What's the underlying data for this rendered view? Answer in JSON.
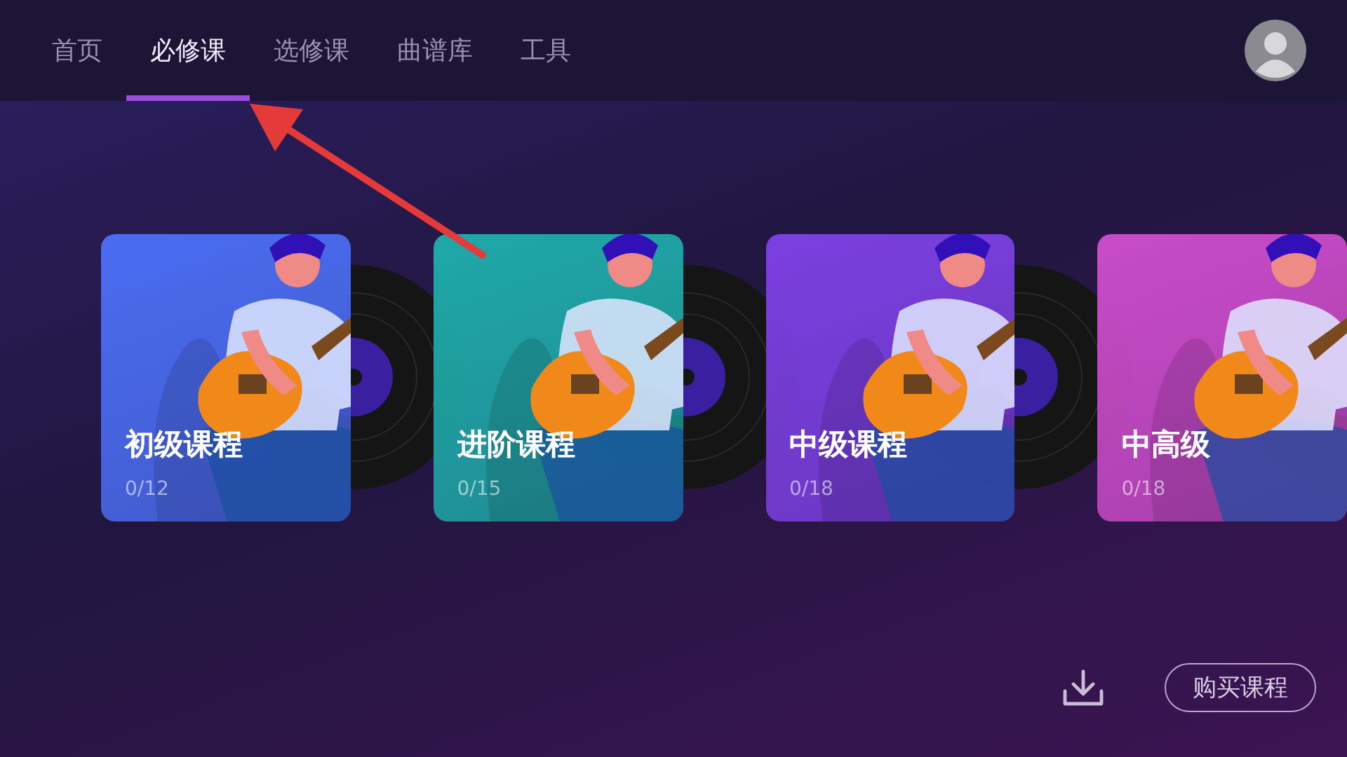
{
  "tabs": [
    {
      "label": "首页",
      "selected": false
    },
    {
      "label": "必修课",
      "selected": true
    },
    {
      "label": "选修课",
      "selected": false
    },
    {
      "label": "曲谱库",
      "selected": false
    },
    {
      "label": "工具",
      "selected": false
    }
  ],
  "courses": [
    {
      "title": "初级课程",
      "progress": "0/12",
      "color": "#4a6cf0"
    },
    {
      "title": "进阶课程",
      "progress": "0/15",
      "color": "#1fa8a8"
    },
    {
      "title": "中级课程",
      "progress": "0/18",
      "color": "#7b3fe0"
    },
    {
      "title": "中高级",
      "progress": "0/18",
      "color": "#c84bc8"
    }
  ],
  "buy_button": "购买课程"
}
